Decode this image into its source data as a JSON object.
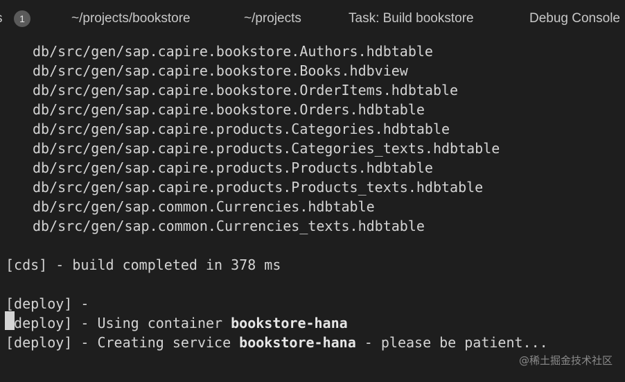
{
  "tabs": [
    {
      "label": "s",
      "badge": "1"
    },
    {
      "label": "~/projects/bookstore"
    },
    {
      "label": "~/projects"
    },
    {
      "label": "Task: Build bookstore"
    },
    {
      "label": "Debug Console"
    }
  ],
  "terminal": {
    "files": [
      "db/src/gen/sap.capire.bookstore.Authors.hdbtable",
      "db/src/gen/sap.capire.bookstore.Books.hdbview",
      "db/src/gen/sap.capire.bookstore.OrderItems.hdbtable",
      "db/src/gen/sap.capire.bookstore.Orders.hdbtable",
      "db/src/gen/sap.capire.products.Categories.hdbtable",
      "db/src/gen/sap.capire.products.Categories_texts.hdbtable",
      "db/src/gen/sap.capire.products.Products.hdbtable",
      "db/src/gen/sap.capire.products.Products_texts.hdbtable",
      "db/src/gen/sap.common.Currencies.hdbtable",
      "db/src/gen/sap.common.Currencies_texts.hdbtable"
    ],
    "build_line": "[cds] - build completed in 378 ms",
    "deploy_line_1": "[deploy] -",
    "deploy_line_2_prefix": "[deploy] - Using container ",
    "deploy_line_2_bold": "bookstore-hana",
    "deploy_line_3_prefix": "[deploy] - Creating service ",
    "deploy_line_3_bold": "bookstore-hana",
    "deploy_line_3_suffix": " - please be patient..."
  },
  "watermark": "@稀土掘金技术社区"
}
